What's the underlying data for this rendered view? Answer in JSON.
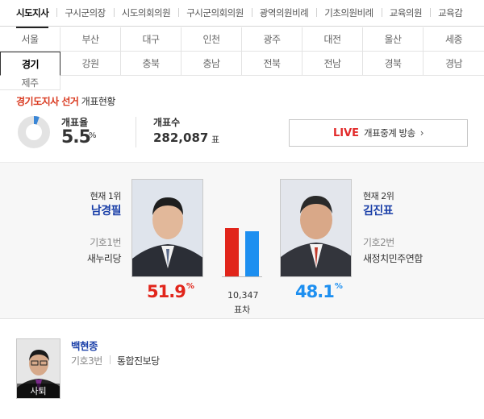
{
  "categories": {
    "items": [
      "시도지사",
      "구시군의장",
      "시도의회의원",
      "구시군의회의원",
      "광역의원비례",
      "기초의원비례",
      "교육의원",
      "교육감"
    ],
    "active_index": 0
  },
  "regions": {
    "items": [
      "서울",
      "부산",
      "대구",
      "인천",
      "광주",
      "대전",
      "울산",
      "세종",
      "강원",
      "충북",
      "충남",
      "전북",
      "전남",
      "경북",
      "경남",
      "제주"
    ],
    "active_label": "경기"
  },
  "summary": {
    "title_highlight": "경기도지사 선거",
    "title_rest": "개표현황",
    "count_rate_label": "개표율",
    "count_rate_value": "5.5",
    "count_rate_unit": "%",
    "count_rate": 0.055,
    "vote_count_label": "개표수",
    "vote_count_value": "282,087",
    "vote_count_unit": "표",
    "live_label": "LIVE",
    "live_text": "개표중계 방송",
    "live_chevron": "›"
  },
  "candidates": [
    {
      "rank": "현재 1위",
      "name": "남경필",
      "number": "기호1번",
      "party": "새누리당",
      "percent": "51.9",
      "percent_value": 51.9,
      "color": "#e1251b"
    },
    {
      "rank": "현재 2위",
      "name": "김진표",
      "number": "기호2번",
      "party": "새정치민주연합",
      "percent": "48.1",
      "percent_value": 48.1,
      "color": "#1d8ff0"
    }
  ],
  "gap": {
    "value": "10,347",
    "label": "표차"
  },
  "resigned": {
    "name": "백현종",
    "number": "기호3번",
    "party": "통합진보당",
    "tag": "사퇴"
  },
  "percent_unit": "%"
}
